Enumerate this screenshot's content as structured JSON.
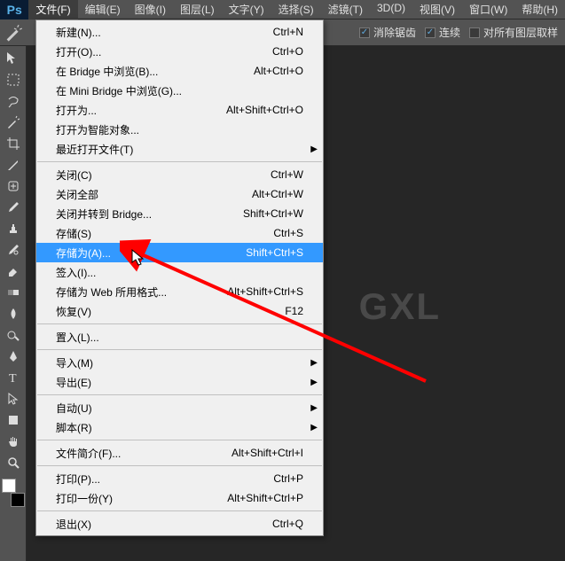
{
  "app": {
    "logo": "Ps"
  },
  "menubar": [
    "文件(F)",
    "编辑(E)",
    "图像(I)",
    "图层(L)",
    "文字(Y)",
    "选择(S)",
    "滤镜(T)",
    "3D(D)",
    "视图(V)",
    "窗口(W)",
    "帮助(H)"
  ],
  "menubar_active_index": 0,
  "optionsbar": {
    "antialias_label": "消除锯齿",
    "contiguous_label": "连续",
    "alllayers_label": "对所有图层取样"
  },
  "dropdown": {
    "groups": [
      [
        {
          "label": "新建(N)...",
          "shortcut": "Ctrl+N"
        },
        {
          "label": "打开(O)...",
          "shortcut": "Ctrl+O"
        },
        {
          "label": "在 Bridge 中浏览(B)...",
          "shortcut": "Alt+Ctrl+O"
        },
        {
          "label": "在 Mini Bridge 中浏览(G)..."
        },
        {
          "label": "打开为...",
          "shortcut": "Alt+Shift+Ctrl+O"
        },
        {
          "label": "打开为智能对象..."
        },
        {
          "label": "最近打开文件(T)",
          "submenu": true
        }
      ],
      [
        {
          "label": "关闭(C)",
          "shortcut": "Ctrl+W"
        },
        {
          "label": "关闭全部",
          "shortcut": "Alt+Ctrl+W"
        },
        {
          "label": "关闭并转到 Bridge...",
          "shortcut": "Shift+Ctrl+W"
        },
        {
          "label": "存储(S)",
          "shortcut": "Ctrl+S"
        },
        {
          "label": "存储为(A)...",
          "shortcut": "Shift+Ctrl+S",
          "highlighted": true
        },
        {
          "label": "签入(I)..."
        },
        {
          "label": "存储为 Web 所用格式...",
          "shortcut": "Alt+Shift+Ctrl+S"
        },
        {
          "label": "恢复(V)",
          "shortcut": "F12"
        }
      ],
      [
        {
          "label": "置入(L)..."
        }
      ],
      [
        {
          "label": "导入(M)",
          "submenu": true
        },
        {
          "label": "导出(E)",
          "submenu": true
        }
      ],
      [
        {
          "label": "自动(U)",
          "submenu": true
        },
        {
          "label": "脚本(R)",
          "submenu": true
        }
      ],
      [
        {
          "label": "文件简介(F)...",
          "shortcut": "Alt+Shift+Ctrl+I"
        }
      ],
      [
        {
          "label": "打印(P)...",
          "shortcut": "Ctrl+P"
        },
        {
          "label": "打印一份(Y)",
          "shortcut": "Alt+Shift+Ctrl+P"
        }
      ],
      [
        {
          "label": "退出(X)",
          "shortcut": "Ctrl+Q"
        }
      ]
    ]
  },
  "watermark": "GXL"
}
